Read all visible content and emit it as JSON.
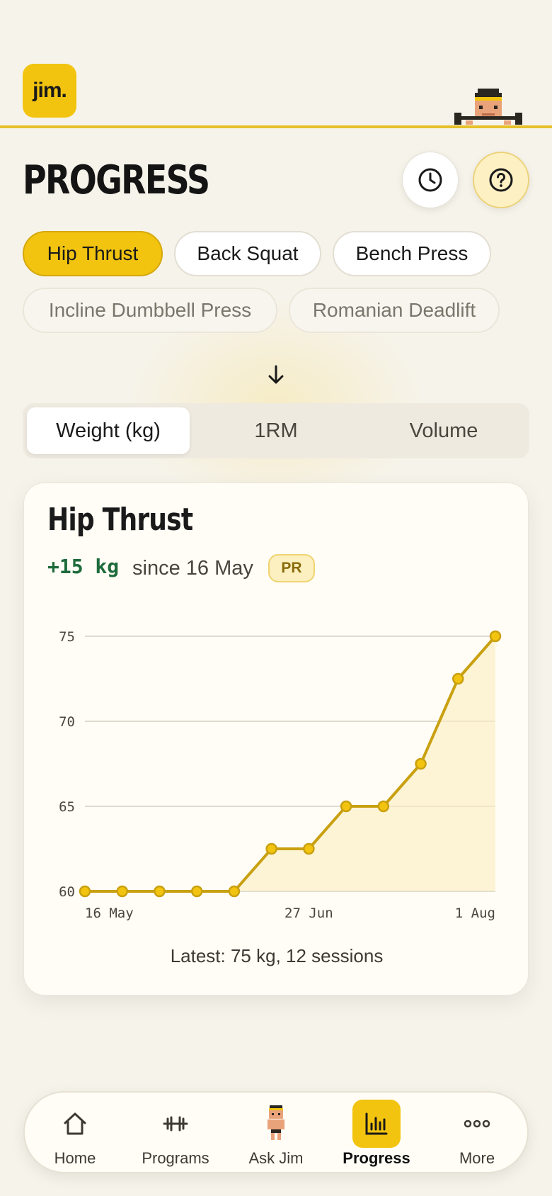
{
  "app": {
    "logo_text": "jim."
  },
  "page": {
    "title": "PROGRESS"
  },
  "header_icons": {
    "history": "clock-icon",
    "help": "help-circle-icon"
  },
  "exercises": [
    {
      "label": "Hip Thrust",
      "state": "active"
    },
    {
      "label": "Back Squat",
      "state": "default"
    },
    {
      "label": "Bench Press",
      "state": "default"
    },
    {
      "label": "Incline Dumbbell Press",
      "state": "muted"
    },
    {
      "label": "Romanian Deadlift",
      "state": "muted"
    }
  ],
  "metrics": {
    "tabs": [
      "Weight (kg)",
      "1RM",
      "Volume"
    ],
    "selected": "Weight (kg)"
  },
  "card": {
    "title": "Hip Thrust",
    "delta": "+15 kg",
    "since": "since 16 May",
    "badge": "PR",
    "caption": "Latest: 75 kg, 12 sessions"
  },
  "chart_data": {
    "type": "area",
    "x_tick_labels": [
      "16 May",
      "27 Jun",
      "1 Aug"
    ],
    "y_ticks": [
      60,
      65,
      70,
      75
    ],
    "ylim": [
      60,
      75
    ],
    "grid": true,
    "values": [
      60,
      60,
      60,
      60,
      60,
      62.5,
      62.5,
      65,
      65,
      67.5,
      72.5,
      75
    ],
    "line_color": "#c9a010",
    "point_color": "#f2c40f",
    "fill_color": "#fbeec2"
  },
  "nav": {
    "items": [
      {
        "label": "Home",
        "icon": "home-icon"
      },
      {
        "label": "Programs",
        "icon": "dumbbell-icon"
      },
      {
        "label": "Ask Jim",
        "icon": "mascot-icon"
      },
      {
        "label": "Progress",
        "icon": "bar-chart-icon"
      },
      {
        "label": "More",
        "icon": "more-dots-icon"
      }
    ],
    "active": "Progress"
  },
  "colors": {
    "accent": "#f2c40f",
    "positive": "#1d6b3b",
    "background": "#f6f3ea"
  }
}
